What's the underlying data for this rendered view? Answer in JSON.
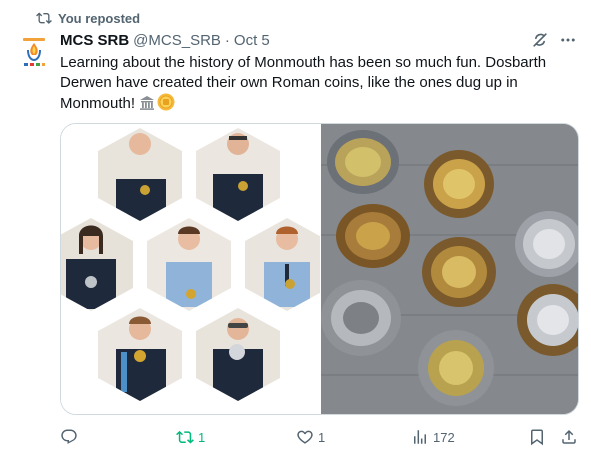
{
  "repost": {
    "label": "You reposted",
    "icon": "repost-icon"
  },
  "author": {
    "name": "MCS SRB",
    "handle": "@MCS_SRB",
    "separator": "·",
    "date": "Oct 5"
  },
  "tweet": {
    "text": "Learning about the history of Monmouth has been so much fun. Dosbarth Derwen have created their own Roman coins, like the ones dug up in Monmouth!",
    "emojis": [
      "classical-building-icon",
      "coin-icon"
    ]
  },
  "media": {
    "left_image": "students-holding-coins-hexagon-collage",
    "right_image": "handmade-roman-coins-on-carpet"
  },
  "actions": {
    "reply_count": "",
    "repost_count": "1",
    "like_count": "1",
    "views_count": "172"
  },
  "colors": {
    "text": "#0f1419",
    "secondary": "#536471",
    "repost_active": "#00ba7c",
    "border": "#cfd9de"
  }
}
